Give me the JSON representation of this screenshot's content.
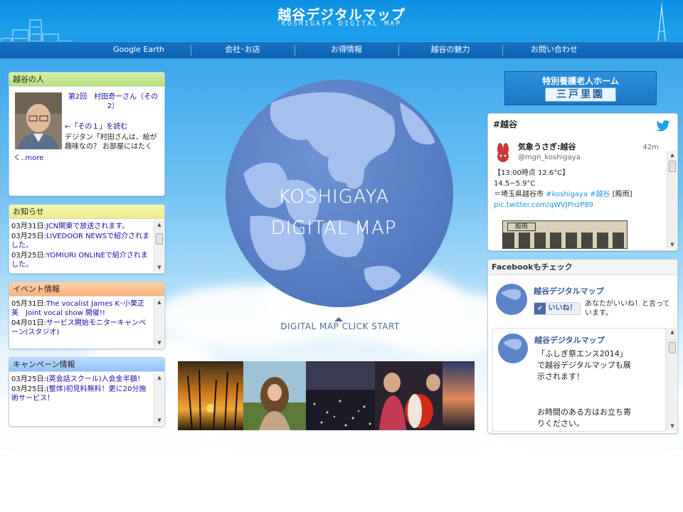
{
  "header": {
    "title_jp": "越谷デジタルマップ",
    "title_en": "KOSHIGAYA DIGITAL MAP"
  },
  "nav": {
    "items": [
      {
        "label": "Google Earth"
      },
      {
        "label": "会社･お店"
      },
      {
        "label": "お得情報"
      },
      {
        "label": "越谷の魅力"
      },
      {
        "label": "お問い合わせ"
      }
    ]
  },
  "panels": {
    "person": {
      "title": "越谷の人",
      "headline": "第2回　村田奇一さん（その2）",
      "prev_link": "←「その１」を読む",
      "body": "デジタン「村田さんは、絵が趣味なの？ お部屋にはたく",
      "more": "..more"
    },
    "news": {
      "title": "お知らせ",
      "items": [
        {
          "date": "03月31日:",
          "text": "JCN関東で放送されます。"
        },
        {
          "date": "03月25日:",
          "text": "LIVEDOOR NEWSで紹介されました。"
        },
        {
          "date": "03月25日:",
          "text": "YOMIURI ONLINEで紹介されました。"
        }
      ]
    },
    "events": {
      "title": "イベント情報",
      "items": [
        {
          "date": "05月31日:",
          "text": "The vocalist James K･小栗正美　Joint vocal show 開催!!"
        },
        {
          "date": "04月01日:",
          "text": "サービス開始モニターキャンペーン(スタジオ)"
        }
      ]
    },
    "campaigns": {
      "title": "キャンペーン情報",
      "items": [
        {
          "date": "03月25日:",
          "text": "(英会話スクール)入会金半額！"
        },
        {
          "date": "03月25日:",
          "text": "(整体)初見料無料！更に20分施術サービス！"
        }
      ]
    }
  },
  "globe": {
    "line1": "KOSHIGAYA",
    "line2": "DIGITAL MAP",
    "click": "DIGITAL MAP CLICK START"
  },
  "banner": {
    "line1": "特別養護老人ホーム",
    "line2": "三戸里園"
  },
  "twitter": {
    "hashtag": "#越谷",
    "user_name": "気象うさぎ:越谷",
    "user_handle": "@mgn_koshigaya",
    "time": "42m",
    "tweet_line1": "【13:00時点 12.6°C】",
    "tweet_line2": "14.5~5.9°C",
    "tweet_line3_prefix": "＝埼玉県越谷市 ",
    "tweet_tag1": "#koshigaya",
    "tweet_tag2": "#越谷",
    "tweet_line3_suffix": " [殿雨]",
    "tweet_link": "pic.twitter.com/qWVJPnzP89",
    "img_label": "殿雨"
  },
  "facebook": {
    "title": "Facebookもチェック",
    "page_name": "越谷デジタルマップ",
    "like_button": "いいね！",
    "like_text": "あなたがいいね！と言っています。",
    "post_author": "越谷デジタルマップ",
    "post_text": "「ふしぎ祭エンス2014」で越谷デジタルマップも展示されます！",
    "post_text2": "お時間のある方はお立ち寄りください。"
  },
  "colors": {
    "header_blue": "#0a8fe3",
    "nav_blue": "#1573c6",
    "globe_dark": "#5d83c8",
    "globe_light": "#a9c2ee",
    "twitter_blue": "#1da1f2",
    "link_blue": "#1a0dab"
  }
}
